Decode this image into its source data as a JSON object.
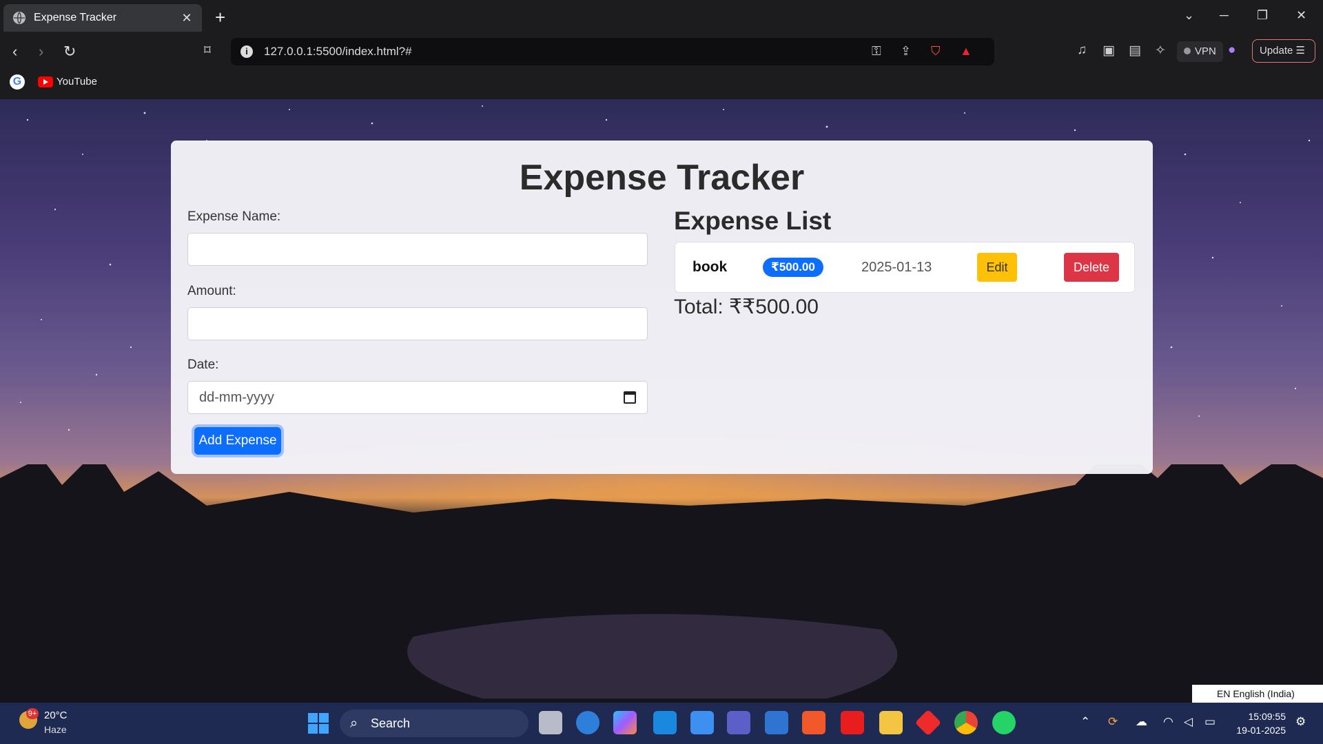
{
  "browser": {
    "tab_title": "Expense Tracker",
    "tab_close": "✕",
    "new_tab": "+",
    "url": "127.0.0.1:5500/index.html?#",
    "vpn_label": "VPN",
    "update_label": "Update",
    "bookmarks": [
      {
        "label": "YouTube"
      }
    ]
  },
  "app": {
    "title": "Expense Tracker",
    "form": {
      "name_label": "Expense Name:",
      "name_value": "",
      "amount_label": "Amount:",
      "amount_value": "",
      "date_label": "Date:",
      "date_placeholder": "dd-mm-yyyy",
      "submit_label": "Add Expense"
    },
    "list": {
      "title": "Expense List",
      "items": [
        {
          "name": "book",
          "amount": "₹500.00",
          "date": "2025-01-13",
          "edit_label": "Edit",
          "delete_label": "Delete"
        }
      ],
      "total": "Total: ₹₹500.00"
    }
  },
  "language_indicator": "EN English (India)",
  "taskbar": {
    "weather_badge": "9+",
    "temperature": "20°C",
    "condition": "Haze",
    "search_label": "Search",
    "time": "15:09:55",
    "date": "19-01-2025"
  },
  "colors": {
    "primary": "#0d6efd",
    "warning": "#ffc107",
    "danger": "#dc3545",
    "taskbar": "#1e2a52"
  }
}
